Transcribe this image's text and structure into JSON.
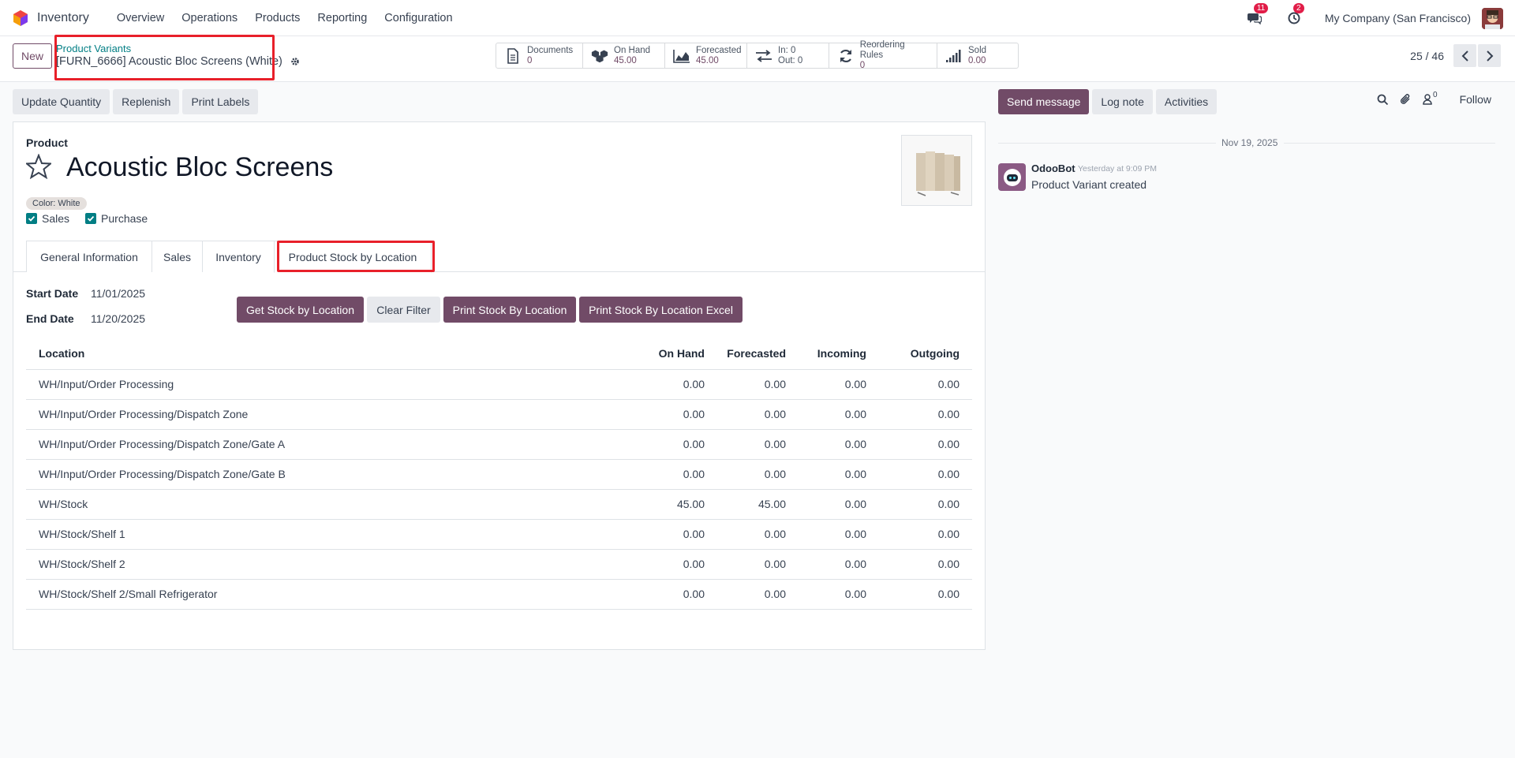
{
  "nav": {
    "app_name": "Inventory",
    "menu": [
      "Overview",
      "Operations",
      "Products",
      "Reporting",
      "Configuration"
    ],
    "messages_badge": "11",
    "activities_badge": "2",
    "company": "My Company (San Francisco)"
  },
  "control": {
    "new_label": "New",
    "breadcrumb_parent": "Product Variants",
    "breadcrumb_current": "[FURN_6666] Acoustic Bloc Screens (White)",
    "smart_buttons": {
      "documents": {
        "label": "Documents",
        "value": "0"
      },
      "on_hand": {
        "label": "On Hand",
        "value": "45.00"
      },
      "forecasted": {
        "label": "Forecasted",
        "value": "45.00"
      },
      "in_out": {
        "in": "In: 0",
        "out": "Out: 0"
      },
      "reordering": {
        "label": "Reordering Rules",
        "value": "0"
      },
      "sold": {
        "label": "Sold",
        "value": "0.00"
      }
    },
    "pager": "25 / 46"
  },
  "actions": {
    "update_quantity": "Update Quantity",
    "replenish": "Replenish",
    "print_labels": "Print Labels"
  },
  "form": {
    "product_label": "Product",
    "product_name": "Acoustic Bloc Screens",
    "attribute_tag": "Color: White",
    "sales_label": "Sales",
    "purchase_label": "Purchase",
    "tabs": [
      "General Information",
      "Sales",
      "Inventory",
      "Product Stock by Location"
    ],
    "start_date_label": "Start Date",
    "start_date": "11/01/2025",
    "end_date_label": "End Date",
    "end_date": "11/20/2025",
    "btn_get_stock": "Get Stock by Location",
    "btn_clear": "Clear Filter",
    "btn_print": "Print Stock By Location",
    "btn_print_excel": "Print Stock By Location Excel",
    "columns": [
      "Location",
      "On Hand",
      "Forecasted",
      "Incoming",
      "Outgoing"
    ],
    "rows": [
      [
        "WH/Input/Order Processing",
        "0.00",
        "0.00",
        "0.00",
        "0.00"
      ],
      [
        "WH/Input/Order Processing/Dispatch Zone",
        "0.00",
        "0.00",
        "0.00",
        "0.00"
      ],
      [
        "WH/Input/Order Processing/Dispatch Zone/Gate A",
        "0.00",
        "0.00",
        "0.00",
        "0.00"
      ],
      [
        "WH/Input/Order Processing/Dispatch Zone/Gate B",
        "0.00",
        "0.00",
        "0.00",
        "0.00"
      ],
      [
        "WH/Stock",
        "45.00",
        "45.00",
        "0.00",
        "0.00"
      ],
      [
        "WH/Stock/Shelf 1",
        "0.00",
        "0.00",
        "0.00",
        "0.00"
      ],
      [
        "WH/Stock/Shelf 2",
        "0.00",
        "0.00",
        "0.00",
        "0.00"
      ],
      [
        "WH/Stock/Shelf 2/Small Refrigerator",
        "0.00",
        "0.00",
        "0.00",
        "0.00"
      ]
    ]
  },
  "chatter": {
    "send_message": "Send message",
    "log_note": "Log note",
    "activities": "Activities",
    "followers_count": "0",
    "follow": "Follow",
    "date_separator": "Nov 19, 2025",
    "author": "OdooBot",
    "time": "Yesterday at 9:09 PM",
    "message": "Product Variant created"
  },
  "colors": {
    "primary": "#714b67",
    "teal": "#017e84",
    "highlight_red": "#e8202a",
    "badge": "#e11d48"
  }
}
